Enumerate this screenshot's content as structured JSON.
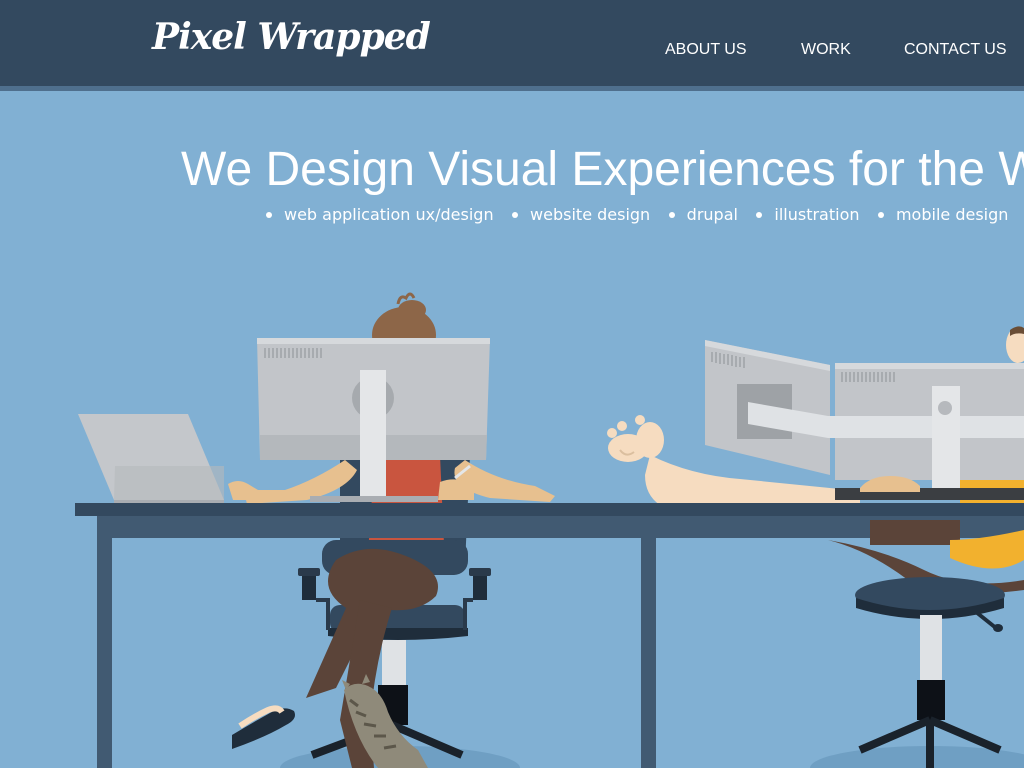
{
  "brand": {
    "logo_text": "Pixel Wrapped"
  },
  "nav": [
    {
      "label": "ABOUT US"
    },
    {
      "label": "WORK"
    },
    {
      "label": "CONTACT US"
    }
  ],
  "hero": {
    "title": "We Design Visual Experiences for the W",
    "services": [
      {
        "label": "web application ux/design"
      },
      {
        "label": "website design"
      },
      {
        "label": "drupal"
      },
      {
        "label": "illustration"
      },
      {
        "label": "mobile design"
      }
    ]
  },
  "colors": {
    "header_bg": "#33495f",
    "page_bg": "#81b0d3",
    "desk": "#33495f",
    "monitor": "#c2c5c9",
    "shirt_red": "#c9553f",
    "shirt_yellow": "#f2b12e"
  }
}
